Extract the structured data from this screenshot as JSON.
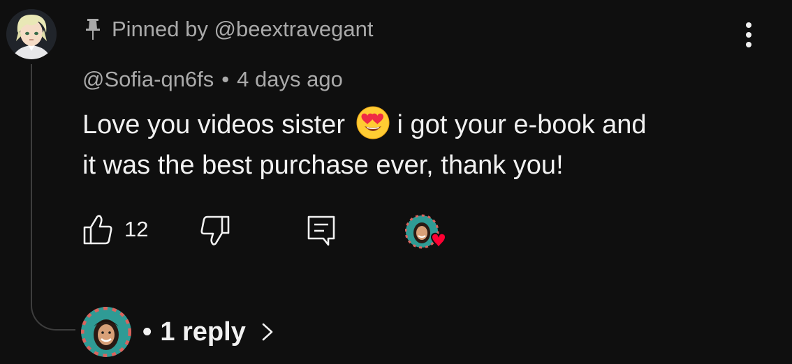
{
  "comment": {
    "pinned_text": "Pinned by @beextravegant",
    "author": "@Sofia-qn6fs",
    "separator": "•",
    "time": "4 days ago",
    "text_line1_a": "Love you videos sister",
    "text_line1_b": "i got your e-book and",
    "text_line2": "it was the best purchase ever, thank you!",
    "emoji": "smiling-face-with-heart-eyes",
    "like_count": "12",
    "replies_bullet": "•",
    "replies_label": "1 reply"
  },
  "icons": {
    "pin": "pin-icon",
    "like": "thumbs-up-icon",
    "dislike": "thumbs-down-icon",
    "reply": "reply-icon",
    "more": "more-vertical-icon",
    "chevron": "chevron-right-icon",
    "creator_heart": "creator-heart-icon"
  },
  "colors": {
    "background": "#0f0f0f",
    "primary_text": "#f1f1f1",
    "secondary_text": "#aaaaaa",
    "heart": "#ff0033",
    "thread_line": "#3d3d3d"
  }
}
